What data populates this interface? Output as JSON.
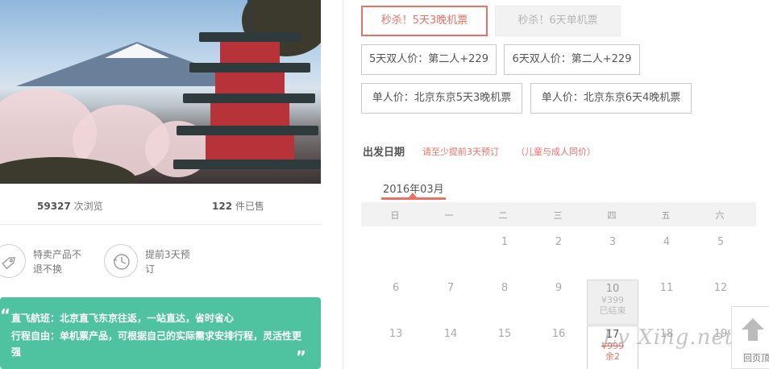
{
  "stats": {
    "views_count": "59327",
    "views_label": "次浏览",
    "sold_count": "122",
    "sold_label": "件已售"
  },
  "features": [
    {
      "icon": "price-tag-icon",
      "text": "特卖产品不退不换"
    },
    {
      "icon": "clock-icon",
      "text": "提前3天预订"
    }
  ],
  "highlights": {
    "line1": "直飞航班：北京直飞东京往返，一站直达，省时省心",
    "line2": "行程自由：单机票产品，可根据自己的实际需求安排行程，灵活性更强",
    "open_quote": "“",
    "close_quote": "”"
  },
  "options": [
    {
      "label": "秒杀！5天3晚机票",
      "state": "active"
    },
    {
      "label": "秒杀！6天单机票",
      "state": "disabled"
    },
    {
      "label": "5天双人价：第二人+229",
      "state": "normal"
    },
    {
      "label": "6天双人价：第二人+229",
      "state": "normal"
    },
    {
      "label": "单人价：北京东京5天3晚机票",
      "state": "normal"
    },
    {
      "label": "单人价：北京东京6天4晚机票",
      "state": "normal"
    }
  ],
  "date_section": {
    "label": "出发日期",
    "note1": "请至少提前3天预订",
    "note2": "（儿童与成人同价）"
  },
  "calendar": {
    "month": "2016年03月",
    "weekdays": [
      "日",
      "一",
      "二",
      "三",
      "四",
      "五",
      "六"
    ],
    "week1": [
      "1",
      "2",
      "3",
      "4",
      "5"
    ],
    "week2": [
      "6",
      "7",
      "8",
      "9",
      "10",
      "11",
      "12"
    ],
    "week3": [
      "13",
      "14",
      "15",
      "16",
      "17",
      "18",
      "19"
    ],
    "day10": {
      "price": "¥399",
      "status": "已结束"
    },
    "day17": {
      "price": "¥999",
      "status": "余2"
    }
  },
  "back_top": {
    "label": "回页顶"
  },
  "watermark": "Lv Xing.net",
  "colors": {
    "accent": "#e8726a",
    "green": "#4fc39f"
  }
}
